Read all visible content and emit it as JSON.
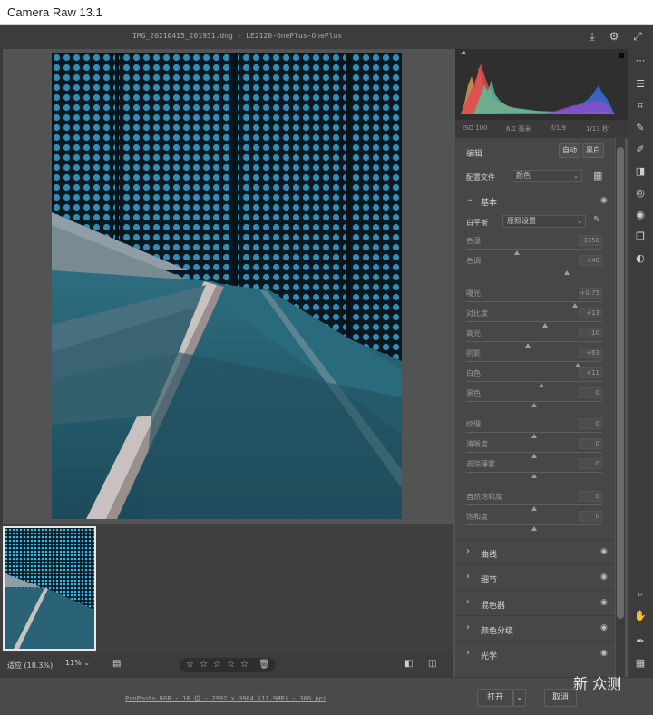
{
  "app": {
    "title": "Camera Raw 13.1"
  },
  "header": {
    "filename": "IMG_20210415_201931.dng  -  LE2120-OnePlus-OnePlus"
  },
  "camera_info": {
    "iso": "ISO 100",
    "focal": "6.1 毫米",
    "aperture": "f/1.9",
    "shutter": "1/13 秒"
  },
  "edit_panel": {
    "title": "编辑",
    "auto_label": "自动",
    "bw_label": "黑白",
    "profile_label": "配置文件",
    "profile_value": "颜色",
    "basic": {
      "title": "基本",
      "wb_label": "白平衡",
      "wb_value": "原照设置",
      "sliders": [
        {
          "label": "色温",
          "value": "3350",
          "pos": 0.37
        },
        {
          "label": "色调",
          "value": "+48",
          "pos": 0.74
        },
        {
          "label": "曝光",
          "value": "+0.75",
          "pos": 0.8
        },
        {
          "label": "对比度",
          "value": "+13",
          "pos": 0.58
        },
        {
          "label": "高光",
          "value": "-10",
          "pos": 0.45
        },
        {
          "label": "阴影",
          "value": "+63",
          "pos": 0.82
        },
        {
          "label": "白色",
          "value": "+11",
          "pos": 0.55
        },
        {
          "label": "黑色",
          "value": "0",
          "pos": 0.5
        },
        {
          "label": "纹理",
          "value": "0",
          "pos": 0.5
        },
        {
          "label": "清晰度",
          "value": "0",
          "pos": 0.5
        },
        {
          "label": "去除薄雾",
          "value": "0",
          "pos": 0.5
        },
        {
          "label": "自然饱和度",
          "value": "0",
          "pos": 0.5
        },
        {
          "label": "饱和度",
          "value": "0",
          "pos": 0.5
        }
      ]
    },
    "sections": [
      "曲线",
      "细节",
      "混色器",
      "颜色分级",
      "光学"
    ]
  },
  "bottom": {
    "zoom_label": "适应 (18.3%)",
    "zoom_select": "11%"
  },
  "footer": {
    "meta_link": "ProPhoto RGB - 16 位 - 2992 x 3984 (11.9MP) - 300 ppi",
    "open_label": "打开",
    "cancel_label": "取消"
  },
  "watermark": "新 众测"
}
